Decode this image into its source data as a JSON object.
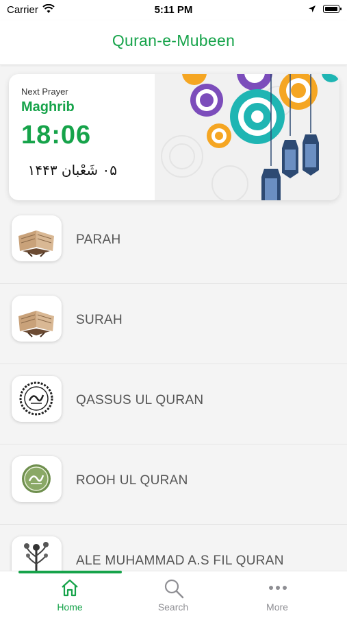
{
  "status_bar": {
    "carrier": "Carrier",
    "time": "5:11 PM"
  },
  "nav": {
    "title": "Quran-e-Mubeen"
  },
  "prayer_card": {
    "label": "Next Prayer",
    "prayer": "Maghrib",
    "time": "18:06",
    "hijri_date": "۰۵ شَعْبان ۱۴۴۳"
  },
  "menu": {
    "items": [
      {
        "label": "PARAH",
        "icon": "quran-book-icon"
      },
      {
        "label": "SURAH",
        "icon": "quran-book-icon"
      },
      {
        "label": "QASSUS UL QURAN",
        "icon": "calligraphy-seal-icon"
      },
      {
        "label": "ROOH UL QURAN",
        "icon": "calligraphy-seal-green-icon"
      },
      {
        "label": "ALE MUHAMMAD A.S FIL QURAN",
        "icon": "calligraphy-tree-icon"
      }
    ]
  },
  "tabs": [
    {
      "label": "Home",
      "icon": "home-icon"
    },
    {
      "label": "Search",
      "icon": "search-icon"
    },
    {
      "label": "More",
      "icon": "more-icon"
    }
  ],
  "colors": {
    "accent": "#16a34a",
    "inactive": "#8e8e93"
  }
}
